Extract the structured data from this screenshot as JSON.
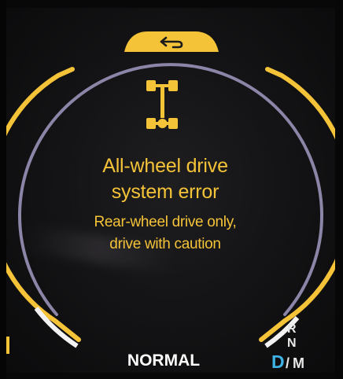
{
  "alert": {
    "title_line1": "All-wheel drive",
    "title_line2": "system error",
    "message_line1": "Rear-wheel drive only,",
    "message_line2": "drive with caution",
    "icon": "awd-drivetrain-icon"
  },
  "back_tab": {
    "icon": "back-arrow-icon"
  },
  "drive_mode": {
    "label": "NORMAL"
  },
  "gear_selector": {
    "r": "R",
    "n": "N",
    "active": "D",
    "separator": "/",
    "m": "M"
  },
  "colors": {
    "alert_amber": "#f5c338",
    "ring_lavender": "#8d85a8",
    "active_gear_blue": "#3fb2e6",
    "text_white": "#ffffff"
  }
}
